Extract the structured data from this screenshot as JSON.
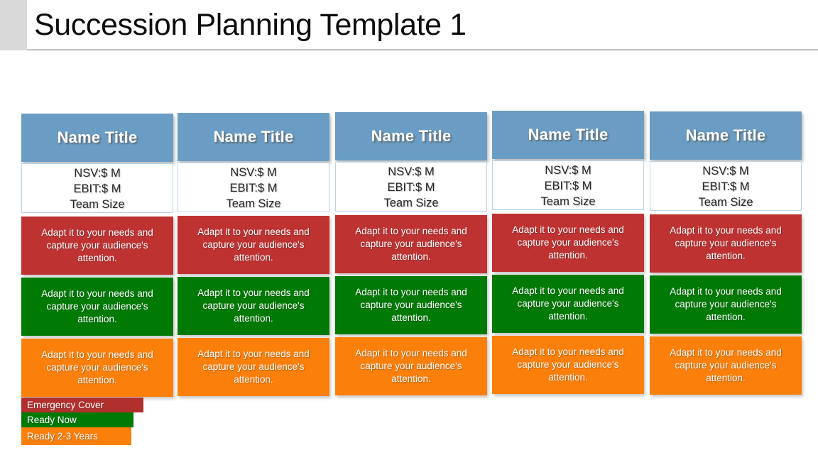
{
  "header": {
    "title": "Succession Planning Template 1"
  },
  "colors": {
    "header_blue": "#6b9dc4",
    "emergency_red": "#bf3232",
    "ready_now_green": "#017a05",
    "ready_2_3_orange": "#fb7f0b",
    "gray_bar": "#d9d9d9",
    "info_border": "#b9d3e8"
  },
  "card_labels": {
    "name_title": "Name Title",
    "nsv": "NSV:$ M",
    "ebit": "EBIT:$ M",
    "team_size": "Team Size",
    "body_text": "Adapt it to your needs and capture your audience's attention."
  },
  "cards": [
    {
      "name_title": "Name Title",
      "nsv": "NSV:$ M",
      "ebit": "EBIT:$ M",
      "team_size": "Team Size",
      "emergency": "Adapt it to your needs and capture your audience's attention.",
      "ready_now": "Adapt it to your needs and capture your audience's attention.",
      "ready_2_3": "Adapt it to your needs and capture your audience's attention."
    },
    {
      "name_title": "Name Title",
      "nsv": "NSV:$ M",
      "ebit": "EBIT:$ M",
      "team_size": "Team Size",
      "emergency": "Adapt it to your needs and capture your audience's attention.",
      "ready_now": "Adapt it to your needs and capture your audience's attention.",
      "ready_2_3": "Adapt it to your needs and capture your audience's attention."
    },
    {
      "name_title": "Name Title",
      "nsv": "NSV:$ M",
      "ebit": "EBIT:$ M",
      "team_size": "Team Size",
      "emergency": "Adapt it to your needs and capture your audience's attention.",
      "ready_now": "Adapt it to your needs and capture your audience's attention.",
      "ready_2_3": "Adapt it to your needs and capture your audience's attention."
    },
    {
      "name_title": "Name Title",
      "nsv": "NSV:$ M",
      "ebit": "EBIT:$ M",
      "team_size": "Team Size",
      "emergency": "Adapt it to your needs and capture your audience's attention.",
      "ready_now": "Adapt it to your needs and capture your audience's attention.",
      "ready_2_3": "Adapt it to your needs and capture your audience's attention."
    },
    {
      "name_title": "Name Title",
      "nsv": "NSV:$ M",
      "ebit": "EBIT:$ M",
      "team_size": "Team Size",
      "emergency": "Adapt it to your needs and capture your audience's attention.",
      "ready_now": "Adapt it to your needs and capture your audience's attention.",
      "ready_2_3": "Adapt it to your needs and capture your audience's attention."
    }
  ],
  "legend": {
    "items": [
      {
        "label": "Emergency Cover",
        "color": "#b12f2c"
      },
      {
        "label": "Ready Now",
        "color": "#017a05"
      },
      {
        "label": "Ready 2-3 Years",
        "color": "#fb7f0b"
      }
    ]
  }
}
